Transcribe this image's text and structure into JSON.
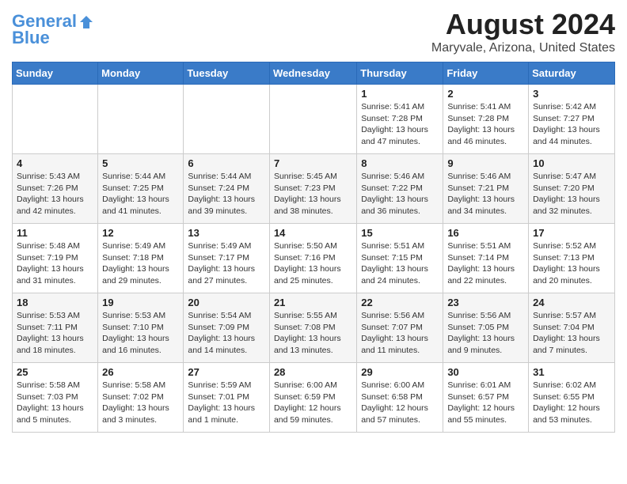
{
  "logo": {
    "line1": "General",
    "line2": "Blue"
  },
  "title": "August 2024",
  "subtitle": "Maryvale, Arizona, United States",
  "weekdays": [
    "Sunday",
    "Monday",
    "Tuesday",
    "Wednesday",
    "Thursday",
    "Friday",
    "Saturday"
  ],
  "weeks": [
    [
      {
        "day": "",
        "info": ""
      },
      {
        "day": "",
        "info": ""
      },
      {
        "day": "",
        "info": ""
      },
      {
        "day": "",
        "info": ""
      },
      {
        "day": "1",
        "info": "Sunrise: 5:41 AM\nSunset: 7:28 PM\nDaylight: 13 hours\nand 47 minutes."
      },
      {
        "day": "2",
        "info": "Sunrise: 5:41 AM\nSunset: 7:28 PM\nDaylight: 13 hours\nand 46 minutes."
      },
      {
        "day": "3",
        "info": "Sunrise: 5:42 AM\nSunset: 7:27 PM\nDaylight: 13 hours\nand 44 minutes."
      }
    ],
    [
      {
        "day": "4",
        "info": "Sunrise: 5:43 AM\nSunset: 7:26 PM\nDaylight: 13 hours\nand 42 minutes."
      },
      {
        "day": "5",
        "info": "Sunrise: 5:44 AM\nSunset: 7:25 PM\nDaylight: 13 hours\nand 41 minutes."
      },
      {
        "day": "6",
        "info": "Sunrise: 5:44 AM\nSunset: 7:24 PM\nDaylight: 13 hours\nand 39 minutes."
      },
      {
        "day": "7",
        "info": "Sunrise: 5:45 AM\nSunset: 7:23 PM\nDaylight: 13 hours\nand 38 minutes."
      },
      {
        "day": "8",
        "info": "Sunrise: 5:46 AM\nSunset: 7:22 PM\nDaylight: 13 hours\nand 36 minutes."
      },
      {
        "day": "9",
        "info": "Sunrise: 5:46 AM\nSunset: 7:21 PM\nDaylight: 13 hours\nand 34 minutes."
      },
      {
        "day": "10",
        "info": "Sunrise: 5:47 AM\nSunset: 7:20 PM\nDaylight: 13 hours\nand 32 minutes."
      }
    ],
    [
      {
        "day": "11",
        "info": "Sunrise: 5:48 AM\nSunset: 7:19 PM\nDaylight: 13 hours\nand 31 minutes."
      },
      {
        "day": "12",
        "info": "Sunrise: 5:49 AM\nSunset: 7:18 PM\nDaylight: 13 hours\nand 29 minutes."
      },
      {
        "day": "13",
        "info": "Sunrise: 5:49 AM\nSunset: 7:17 PM\nDaylight: 13 hours\nand 27 minutes."
      },
      {
        "day": "14",
        "info": "Sunrise: 5:50 AM\nSunset: 7:16 PM\nDaylight: 13 hours\nand 25 minutes."
      },
      {
        "day": "15",
        "info": "Sunrise: 5:51 AM\nSunset: 7:15 PM\nDaylight: 13 hours\nand 24 minutes."
      },
      {
        "day": "16",
        "info": "Sunrise: 5:51 AM\nSunset: 7:14 PM\nDaylight: 13 hours\nand 22 minutes."
      },
      {
        "day": "17",
        "info": "Sunrise: 5:52 AM\nSunset: 7:13 PM\nDaylight: 13 hours\nand 20 minutes."
      }
    ],
    [
      {
        "day": "18",
        "info": "Sunrise: 5:53 AM\nSunset: 7:11 PM\nDaylight: 13 hours\nand 18 minutes."
      },
      {
        "day": "19",
        "info": "Sunrise: 5:53 AM\nSunset: 7:10 PM\nDaylight: 13 hours\nand 16 minutes."
      },
      {
        "day": "20",
        "info": "Sunrise: 5:54 AM\nSunset: 7:09 PM\nDaylight: 13 hours\nand 14 minutes."
      },
      {
        "day": "21",
        "info": "Sunrise: 5:55 AM\nSunset: 7:08 PM\nDaylight: 13 hours\nand 13 minutes."
      },
      {
        "day": "22",
        "info": "Sunrise: 5:56 AM\nSunset: 7:07 PM\nDaylight: 13 hours\nand 11 minutes."
      },
      {
        "day": "23",
        "info": "Sunrise: 5:56 AM\nSunset: 7:05 PM\nDaylight: 13 hours\nand 9 minutes."
      },
      {
        "day": "24",
        "info": "Sunrise: 5:57 AM\nSunset: 7:04 PM\nDaylight: 13 hours\nand 7 minutes."
      }
    ],
    [
      {
        "day": "25",
        "info": "Sunrise: 5:58 AM\nSunset: 7:03 PM\nDaylight: 13 hours\nand 5 minutes."
      },
      {
        "day": "26",
        "info": "Sunrise: 5:58 AM\nSunset: 7:02 PM\nDaylight: 13 hours\nand 3 minutes."
      },
      {
        "day": "27",
        "info": "Sunrise: 5:59 AM\nSunset: 7:01 PM\nDaylight: 13 hours\nand 1 minute."
      },
      {
        "day": "28",
        "info": "Sunrise: 6:00 AM\nSunset: 6:59 PM\nDaylight: 12 hours\nand 59 minutes."
      },
      {
        "day": "29",
        "info": "Sunrise: 6:00 AM\nSunset: 6:58 PM\nDaylight: 12 hours\nand 57 minutes."
      },
      {
        "day": "30",
        "info": "Sunrise: 6:01 AM\nSunset: 6:57 PM\nDaylight: 12 hours\nand 55 minutes."
      },
      {
        "day": "31",
        "info": "Sunrise: 6:02 AM\nSunset: 6:55 PM\nDaylight: 12 hours\nand 53 minutes."
      }
    ]
  ]
}
